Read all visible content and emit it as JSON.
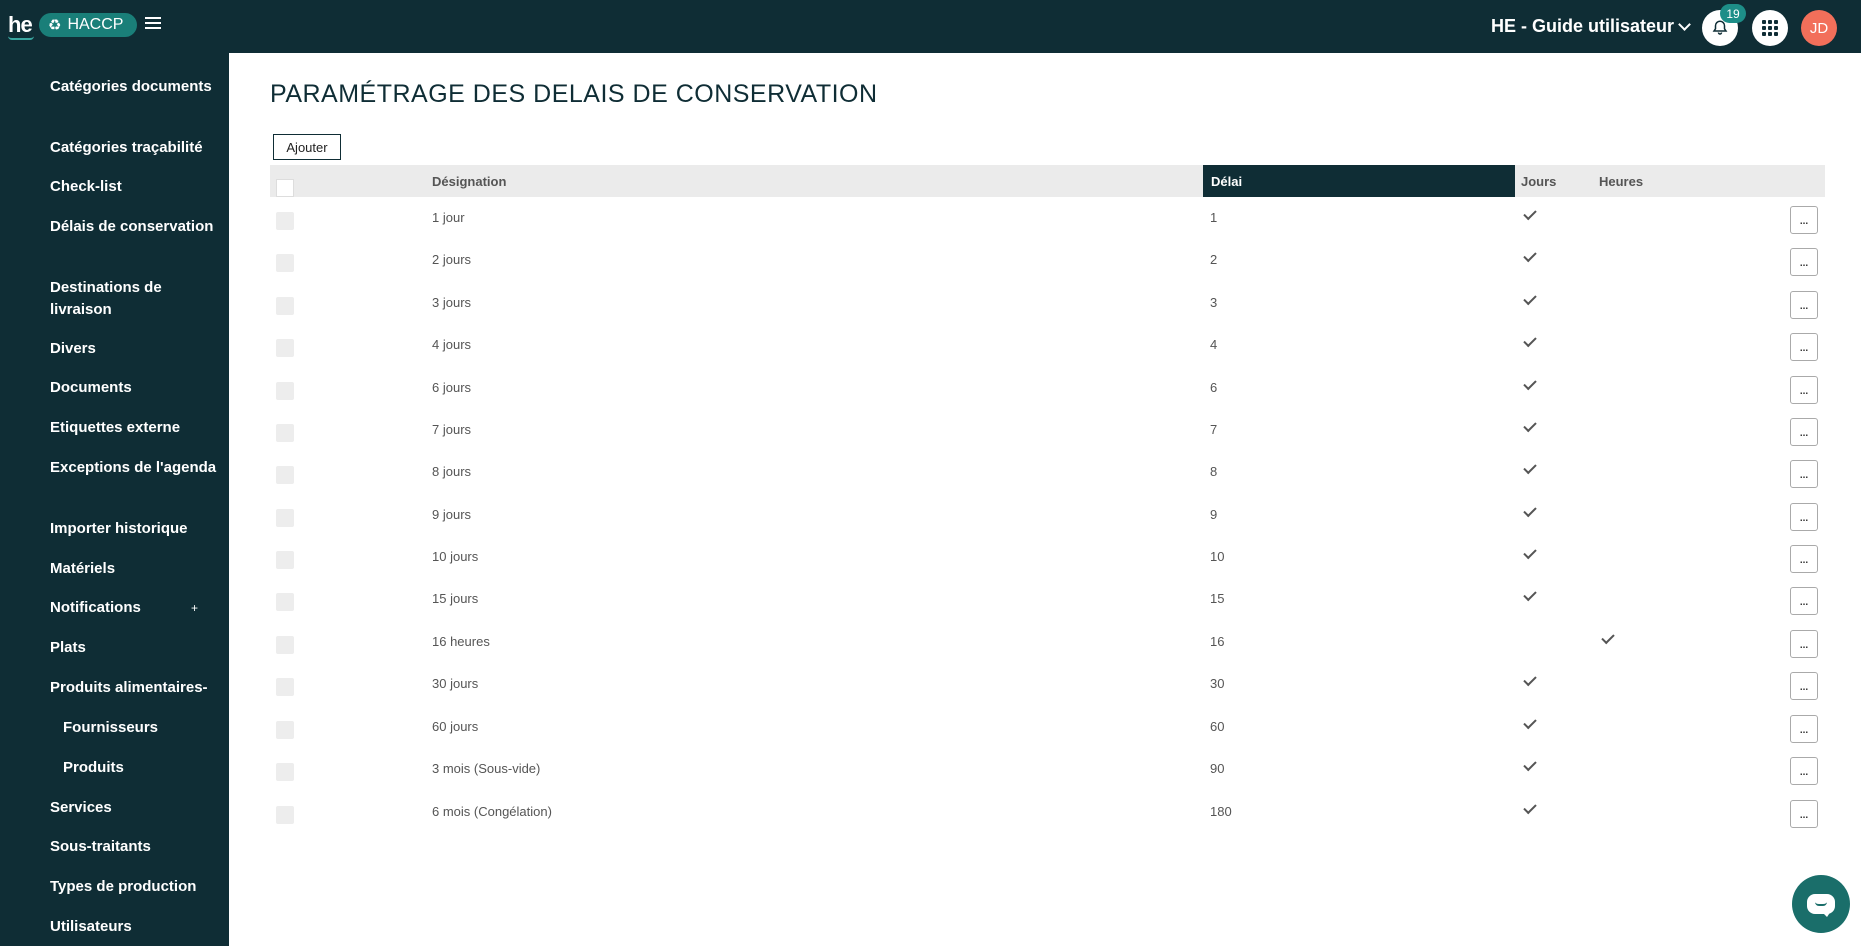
{
  "header": {
    "logo_text": "he",
    "app_pill": "HACCP",
    "guide_label": "HE - Guide utilisateur",
    "notification_count": "19",
    "avatar_initials": "JD"
  },
  "sidebar": {
    "items": [
      {
        "label": "Catégories documents"
      },
      {
        "label": "Catégories traçabilité"
      },
      {
        "label": "Check-list"
      },
      {
        "label": "Délais de conservation"
      },
      {
        "label": "Destinations de livraison"
      },
      {
        "label": "Divers"
      },
      {
        "label": "Documents"
      },
      {
        "label": "Etiquettes externe"
      },
      {
        "label": "Exceptions de l'agenda"
      },
      {
        "label": "Importer historique"
      },
      {
        "label": "Matériels"
      },
      {
        "label": "Notifications",
        "expander": "+"
      },
      {
        "label": "Plats"
      },
      {
        "label": "Produits alimentaires-"
      },
      {
        "label": "Fournisseurs"
      },
      {
        "label": "Produits"
      },
      {
        "label": "Services"
      },
      {
        "label": "Sous-traitants"
      },
      {
        "label": "Types de production"
      },
      {
        "label": "Utilisateurs"
      }
    ]
  },
  "main": {
    "title": "PARAMÉTRAGE DES DELAIS DE CONSERVATION",
    "add_label": "Ajouter",
    "table": {
      "headers": [
        "Désignation",
        "Délai",
        "Jours",
        "Heures"
      ],
      "rows": [
        {
          "designation": "1 jour",
          "delai": "1",
          "unit": "jours",
          "actions": "..."
        },
        {
          "designation": "2 jours",
          "delai": "2",
          "unit": "jours",
          "actions": "..."
        },
        {
          "designation": "3 jours",
          "delai": "3",
          "unit": "jours",
          "actions": "..."
        },
        {
          "designation": "4 jours",
          "delai": "4",
          "unit": "jours",
          "actions": "..."
        },
        {
          "designation": "6 jours",
          "delai": "6",
          "unit": "jours",
          "actions": "..."
        },
        {
          "designation": "7 jours",
          "delai": "7",
          "unit": "jours",
          "actions": "..."
        },
        {
          "designation": "8 jours",
          "delai": "8",
          "unit": "jours",
          "actions": "..."
        },
        {
          "designation": "9 jours",
          "delai": "9",
          "unit": "jours",
          "actions": "..."
        },
        {
          "designation": "10 jours",
          "delai": "10",
          "unit": "jours",
          "actions": "..."
        },
        {
          "designation": "15 jours",
          "delai": "15",
          "unit": "jours",
          "actions": "..."
        },
        {
          "designation": "16 heures",
          "delai": "16",
          "unit": "heures",
          "actions": "..."
        },
        {
          "designation": "30 jours",
          "delai": "30",
          "unit": "jours",
          "actions": "..."
        },
        {
          "designation": "60 jours",
          "delai": "60",
          "unit": "jours",
          "actions": "..."
        },
        {
          "designation": "3 mois (Sous-vide)",
          "delai": "90",
          "unit": "jours",
          "actions": "..."
        },
        {
          "designation": "6 mois (Congélation)",
          "delai": "180",
          "unit": "jours",
          "actions": "..."
        }
      ]
    }
  },
  "colors": {
    "primary_dark": "#0f2d35",
    "accent_teal": "#1a7f79",
    "avatar": "#f26f5a"
  }
}
